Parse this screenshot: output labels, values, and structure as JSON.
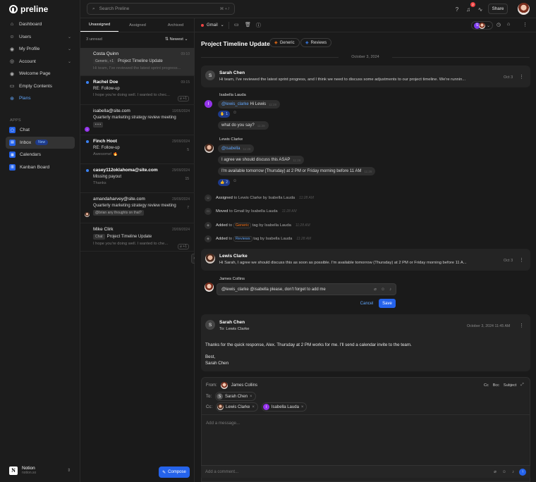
{
  "brand": {
    "name": "preline"
  },
  "sidebar": {
    "items": [
      {
        "label": "Dashboard",
        "icon": "home-icon",
        "glyph": "⌂"
      },
      {
        "label": "Users",
        "icon": "users-icon",
        "glyph": "☺"
      },
      {
        "label": "My Profile",
        "icon": "user-circle-icon",
        "glyph": "◉"
      },
      {
        "label": "Account",
        "icon": "account-icon",
        "glyph": "◎"
      },
      {
        "label": "Welcome Page",
        "icon": "eye-icon",
        "glyph": "◉"
      },
      {
        "label": "Empty Contents",
        "icon": "document-icon",
        "glyph": "▭"
      },
      {
        "label": "Plans",
        "icon": "plans-icon",
        "glyph": "⊕"
      }
    ],
    "apps_label": "APPS",
    "apps": [
      {
        "label": "Chat"
      },
      {
        "label": "Inbox",
        "badge": "New"
      },
      {
        "label": "Calendars"
      },
      {
        "label": "Kanban Board"
      }
    ],
    "workspace": {
      "name": "Notion",
      "url": "notion.so"
    }
  },
  "topbar": {
    "search_placeholder": "Search Preline",
    "search_shortcut": "⌘ + /",
    "notifications_count": "2",
    "share_label": "Share"
  },
  "list": {
    "tabs": [
      "Unassigned",
      "Assigned",
      "Archived"
    ],
    "unread": "3 unread",
    "sort": "Newest",
    "mails": [
      {
        "from": "Costa Quinn",
        "date": "09:10",
        "chip": "Generic, +1",
        "subject": "Project Timeline Update",
        "preview": "Hi team, I've reviewed the latest sprint progress..."
      },
      {
        "from": "Rachel Doe",
        "date": "09:15",
        "subject": "RE: Follow-up",
        "preview": "I hope you're doing well. I wanted to chec...",
        "count": "+1"
      },
      {
        "from": "isabella@site.com",
        "date": "10/05/2024",
        "subject": "Quarterly marketing strategy review meeting",
        "preview": "• • •"
      },
      {
        "from": "Finch Hoot",
        "date": "29/09/2024",
        "subject": "RE: Follow-up",
        "preview": "Awesome! 🔥",
        "count": "5"
      },
      {
        "from": "casey112oklahoma@site.com",
        "date": "29/09/2024",
        "subject": "Missing payout",
        "preview": "Thanks",
        "count": "15"
      },
      {
        "from": "amandaharvey@site.com",
        "date": "29/09/2024",
        "subject": "Quarterly marketing strategy review meeting",
        "preview": "@brian any thoughts on that?",
        "count": "7"
      },
      {
        "from": "Mike Clirk",
        "date": "20/09/2024",
        "chip": "Chat",
        "subject": "Project Timeline Update",
        "preview": "I hope you're doing well. I wanted to che..."
      }
    ],
    "compose_label": "Compose"
  },
  "main": {
    "toolbar": {
      "source": "Gmail"
    },
    "title": "Project Timeline Update",
    "tags": [
      "Generic",
      "Reviews"
    ],
    "date_sep": "October 3, 2024",
    "msg1": {
      "name": "Sarah Chen",
      "initial": "S",
      "text": "Hi team, I've reviewed the latest sprint progress, and I think we need to discuss some adjustments to our project timeline. We're runnin...",
      "date": "Oct 3"
    },
    "thread1": {
      "name": "Isabella Lauda",
      "initial": "I",
      "mention": "@lewis_clarke",
      "text": " Hi Lewis",
      "time": "11:28",
      "react_emoji": "✋",
      "react_count": "1",
      "text2": "what do you say?",
      "time2": "11:28"
    },
    "thread2": {
      "name": "Lewis Clarke",
      "mention": "@isabella",
      "time": "11:28",
      "line1": "I agree we should discuss this ASAP",
      "time1": "11:28",
      "line2": "I'm available tomorrow (Thursday) at 2 PM or Friday morning before 11 AM",
      "time2": "11:28",
      "react_emoji": "👍",
      "react_count": "2"
    },
    "activity": [
      {
        "pre": "Assigned",
        "mid": " to Lewis Clarke by Isabella Lauda",
        "time": "11:28 AM"
      },
      {
        "pre": "Moved",
        "mid": " to Gmail by Isabella Lauda",
        "time": "11:28 AM"
      },
      {
        "pre": "Added",
        "mid": " tag by Isabella Lauda",
        "tag": "Generic",
        "time": "11:28 AM"
      },
      {
        "pre": "Added",
        "mid": " tag by Isabella Lauda",
        "tag": "Reviews",
        "time": "11:28 AM"
      }
    ],
    "msg2": {
      "name": "Lewis Clarke",
      "text": "Hi Sarah, I agree we should discuss this as soon as possible. I'm available tomorrow (Thursday) at 2 PM or Friday morning before 11 A...",
      "date": "Oct 3"
    },
    "edit": {
      "name": "James Collins",
      "text": "@lewis_clarke @isabella please, don't forget to add me",
      "cancel": "Cancel",
      "save": "Save"
    },
    "msg3": {
      "name": "Sarah Chen",
      "initial": "S",
      "to": "To: Lewis Clarke",
      "date": "October 3, 2024 11:45 AM",
      "body1": "Thanks for the quick response, Alex. Thursday at 2 PM works for me. I'll send a calendar invite to the team.",
      "body2": "Best,",
      "body3": "Sarah Chen"
    },
    "reply": {
      "from_label": "From:",
      "from": "James Collins",
      "to_label": "To:",
      "to": "Sarah Chen",
      "cc_label": "Cc:",
      "cc1": "Lewis Clarke",
      "cc2": "Isabella Lauda",
      "opts": [
        "Cc",
        "Bcc",
        "Subject"
      ],
      "placeholder": "Add a message...",
      "comment": "Add a comment..."
    }
  },
  "colors": {
    "accent": "#2563eb",
    "bg": "#171717",
    "panel": "#242424",
    "tag_generic": "#f97316",
    "tag_reviews": "#3b82f6"
  }
}
